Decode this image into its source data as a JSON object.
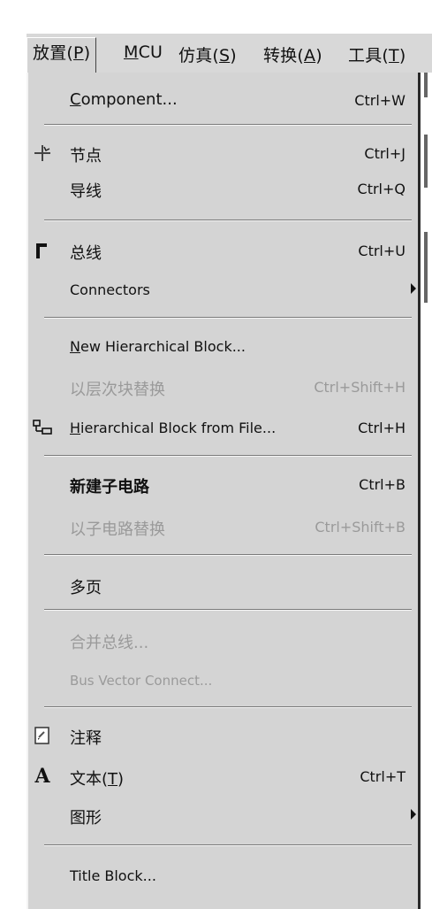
{
  "menubar": {
    "items": [
      {
        "label": "放置(P)"
      },
      {
        "label": "MCU"
      },
      {
        "label": "仿真(S)"
      },
      {
        "label": "转换(A)"
      },
      {
        "label": "工具(T)"
      }
    ]
  },
  "menu": {
    "component": {
      "label": "Component...",
      "shortcut": "Ctrl+W"
    },
    "junction": {
      "label": "节点",
      "shortcut": "Ctrl+J",
      "icon": "junction-icon"
    },
    "wire": {
      "label": "导线",
      "shortcut": "Ctrl+Q"
    },
    "bus": {
      "label": "总线",
      "shortcut": "Ctrl+U",
      "icon": "bus-icon"
    },
    "connectors": {
      "label": "Connectors"
    },
    "new_hier_block": {
      "label": "New Hierarchical Block..."
    },
    "replace_by_hier": {
      "label": "以层次块替换",
      "shortcut": "Ctrl+Shift+H"
    },
    "hier_from_file": {
      "label": "Hierarchical Block from File...",
      "shortcut": "Ctrl+H",
      "icon": "hierarchical-block-icon"
    },
    "new_subcircuit": {
      "label": "新建子电路",
      "shortcut": "Ctrl+B"
    },
    "replace_by_subcircuit": {
      "label": "以子电路替换",
      "shortcut": "Ctrl+Shift+B"
    },
    "multi_page": {
      "label": "多页"
    },
    "merge_bus": {
      "label": "合并总线..."
    },
    "bus_vector_connect": {
      "label": "Bus Vector Connect..."
    },
    "comment": {
      "label": "注释",
      "icon": "comment-icon"
    },
    "text": {
      "label": "文本(T)",
      "shortcut": "Ctrl+T",
      "icon": "text-icon"
    },
    "graphics": {
      "label": "图形"
    },
    "title_block": {
      "label": "Title Block..."
    }
  }
}
